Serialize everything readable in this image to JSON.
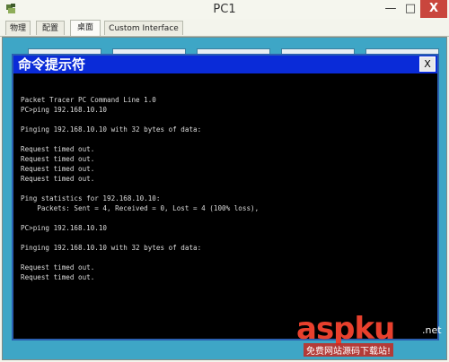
{
  "window": {
    "title": "PC1",
    "minimize_glyph": "—",
    "maximize_glyph": "□",
    "close_glyph": "X"
  },
  "tabs": [
    {
      "label": "物理",
      "active": false
    },
    {
      "label": "配置",
      "active": false
    },
    {
      "label": "桌面",
      "active": true
    },
    {
      "label": "Custom Interface",
      "active": false
    }
  ],
  "cmd": {
    "title": "命令提示符",
    "close_label": "X",
    "lines": [
      "",
      "Packet Tracer PC Command Line 1.0",
      "PC>ping 192.168.10.10",
      "",
      "Pinging 192.168.10.10 with 32 bytes of data:",
      "",
      "Request timed out.",
      "Request timed out.",
      "Request timed out.",
      "Request timed out.",
      "",
      "Ping statistics for 192.168.10.10:",
      "    Packets: Sent = 4, Received = 0, Lost = 4 (100% loss),",
      "",
      "PC>ping 192.168.10.10",
      "",
      "Pinging 192.168.10.10 with 32 bytes of data:",
      "",
      "Request timed out.",
      "Request timed out."
    ]
  },
  "watermark": {
    "main": "aspku",
    "suffix": ".net",
    "sub": "免费网站源码下载站!"
  },
  "colors": {
    "cmd_titlebar": "#0a2bd8",
    "desktop_bg": "#3ea6c6",
    "terminal_text": "#dcdcdc",
    "close_button": "#c9463d"
  }
}
